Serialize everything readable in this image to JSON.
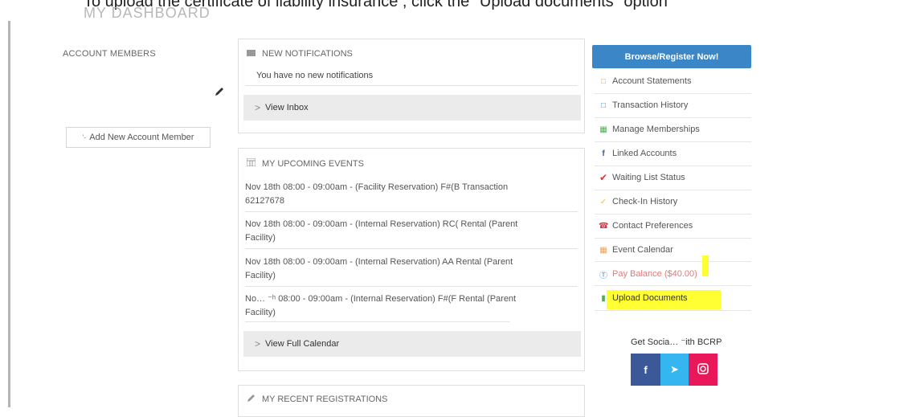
{
  "instruction": "To upload the certificate of liability insurance , click the \"Upload documents\" option",
  "dashboard_title": "MY DASHBOARD",
  "account_members": {
    "label": "ACCOUNT MEMBERS",
    "add_button": "Add New Account Member"
  },
  "notifications": {
    "title": "NEW NOTIFICATIONS",
    "message": "You have no new notifications",
    "view_inbox": "View Inbox"
  },
  "upcoming_events": {
    "title": "MY UPCOMING EVENTS",
    "events": [
      {
        "line1": "Nov 18th 08:00 - 09:00am - (Facility Reservation) F#(B Transaction",
        "line2": "62127678"
      },
      {
        "line1": "Nov 18th 08:00 - 09:00am - (Internal Reservation) RC( Rental (Parent",
        "line2": "Facility)"
      },
      {
        "line1": "Nov 18th 08:00 - 09:00am - (Internal Reservation) AA Rental (Parent",
        "line2": "Facility)"
      },
      {
        "line1": "No… ⁻ʰ 08:00 - 09:00am - (Internal Reservation) F#(F Rental (Parent",
        "line2": "Facility)"
      }
    ],
    "view_calendar": "View Full Calendar"
  },
  "recent_registrations": {
    "title": "MY RECENT REGISTRATIONS"
  },
  "sidebar": {
    "browse_button": "Browse/Register Now!",
    "items": [
      {
        "label": "Account Statements",
        "icon": "statement-icon",
        "color": "#e8a060"
      },
      {
        "label": "Transaction History",
        "icon": "history-icon",
        "color": "#4a90d9"
      },
      {
        "label": "Manage Memberships",
        "icon": "membership-icon",
        "color": "#4caf50"
      },
      {
        "label": "Linked Accounts",
        "icon": "facebook-icon",
        "color": "#3b5998"
      },
      {
        "label": "Waiting List Status",
        "icon": "check-icon",
        "color": "#d9323c"
      },
      {
        "label": "Check-In History",
        "icon": "checkmark-icon",
        "color": "#f0c040"
      },
      {
        "label": "Contact Preferences",
        "icon": "phone-icon",
        "color": "#d9323c"
      },
      {
        "label": "Event Calendar",
        "icon": "calendar-icon",
        "color": "#f0a050"
      },
      {
        "label": "Pay Balance ($40.00)",
        "icon": "dollar-icon",
        "color": "#4a90d9"
      },
      {
        "label": "Upload Documents",
        "icon": "document-icon",
        "color": "#4caf50"
      }
    ]
  },
  "social": {
    "label": "Get Socia… ⁻ith BCRP",
    "colors": {
      "facebook": "#3b5998",
      "twitter": "#35b6f0",
      "instagram": "#e8185a"
    }
  },
  "highlight_color": "#ffff33"
}
